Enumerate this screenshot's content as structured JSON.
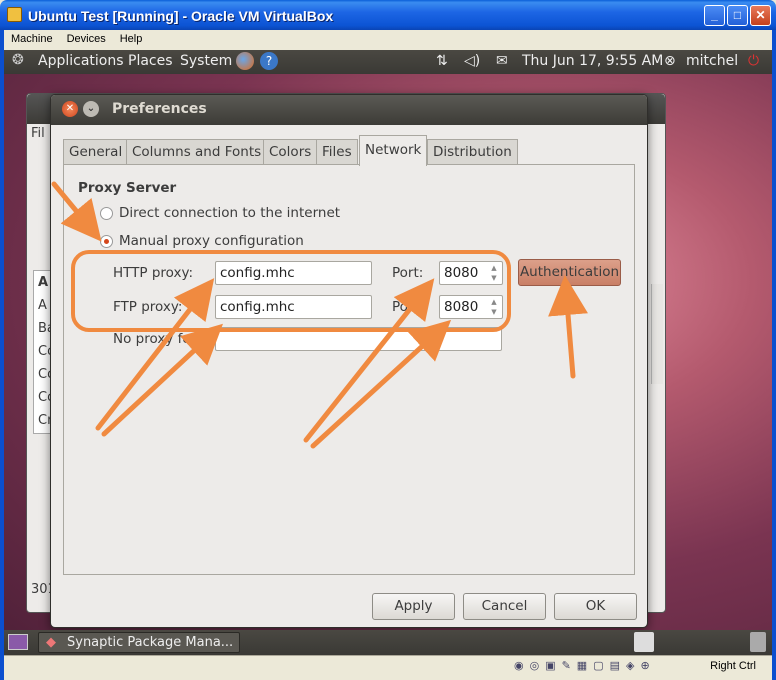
{
  "host_window": {
    "title": "Ubuntu Test [Running] - Oracle VM VirtualBox",
    "menu": [
      "Machine",
      "Devices",
      "Help"
    ],
    "status_host_key": "Right Ctrl"
  },
  "top_panel": {
    "applications": "Applications",
    "places": "Places",
    "system": "System",
    "clock": "Thu Jun 17,  9:55 AM",
    "user": "mitchel"
  },
  "taskbar": {
    "task_label": "Synaptic Package Mana..."
  },
  "background_window": {
    "file_menu": "Fil",
    "list_items": [
      "A",
      "A",
      "Ba",
      "Co",
      "Co",
      "Co",
      "Cr"
    ],
    "status": "301"
  },
  "dialog": {
    "title": "Preferences",
    "tabs": [
      "General",
      "Columns and Fonts",
      "Colors",
      "Files",
      "Network",
      "Distribution"
    ],
    "active_tab": "Network",
    "section_title": "Proxy Server",
    "direct_label": "Direct connection to the internet",
    "manual_label": "Manual proxy configuration",
    "http_label": "HTTP proxy:",
    "http_value": "config.mhc",
    "ftp_label": "FTP proxy:",
    "ftp_value": "config.mhc",
    "port_label": "Port:",
    "http_port": "8080",
    "ftp_port": "8080",
    "no_proxy_label": "No proxy for:",
    "no_proxy_value": "",
    "authentication_label": "Authentication",
    "apply_label": "Apply",
    "cancel_label": "Cancel",
    "ok_label": "OK"
  },
  "colors": {
    "annotation": "#f08a40",
    "ubuntu_orange": "#d4461b",
    "panel": "#3c3b37"
  }
}
